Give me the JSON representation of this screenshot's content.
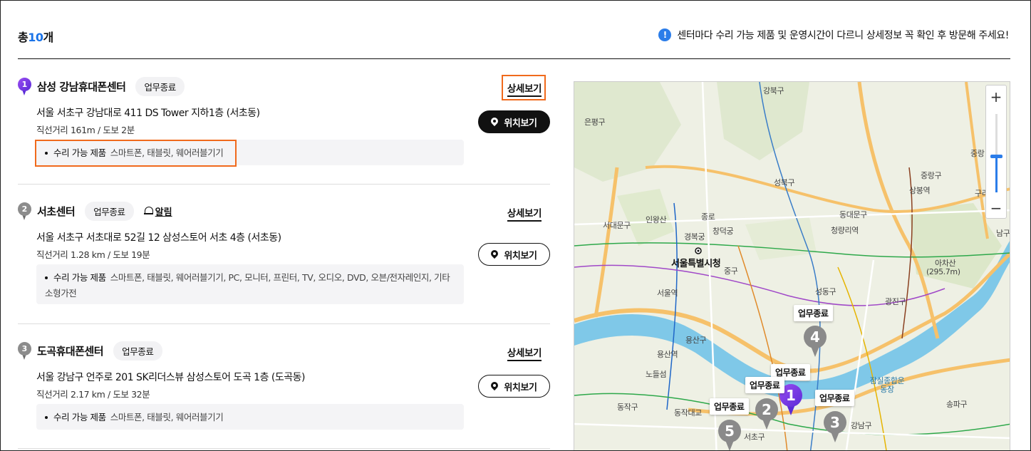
{
  "header": {
    "total_prefix": "총",
    "total_count": "10",
    "total_suffix": "개",
    "notice": "센터마다 수리 가능 제품 및 운영시간이 다르니 상세정보 꼭 확인 후 방문해 주세요!"
  },
  "centers": [
    {
      "number": "1",
      "name": "삼성 강남휴대폰센터",
      "status": "업무종료",
      "address": "서울 서초구 강남대로 411 DS Tower 지하1층 (서초동)",
      "distance": "직선거리 161m / 도보 2분",
      "repair_label": "수리 가능 제품",
      "repair_products": "스마트폰, 태블릿, 웨어러블기기",
      "detail_label": "상세보기",
      "location_label": "위치보기"
    },
    {
      "number": "2",
      "name": "서초센터",
      "status": "업무종료",
      "alarm_label": "알림",
      "address": "서울 서초구 서초대로 52길 12 삼성스토어 서초 4층 (서초동)",
      "distance": "직선거리 1.28 km / 도보 19분",
      "repair_label": "수리 가능 제품",
      "repair_products": "스마트폰, 태블릿, 웨어러블기기, PC, 모니터, 프린터, TV, 오디오, DVD, 오븐/전자레인지, 기타 소형가전",
      "detail_label": "상세보기",
      "location_label": "위치보기"
    },
    {
      "number": "3",
      "name": "도곡휴대폰센터",
      "status": "업무종료",
      "address": "서울 강남구 언주로 201 SK리더스뷰 삼성스토어 도곡 1층 (도곡동)",
      "distance": "직선거리 2.17 km / 도보 32분",
      "repair_label": "수리 가능 제품",
      "repair_products": "스마트폰, 태블릿, 웨어러블기기",
      "detail_label": "상세보기",
      "location_label": "위치보기"
    }
  ],
  "map": {
    "zoom_in": "+",
    "zoom_out": "−",
    "labels": [
      "강북구",
      "은평구",
      "성북구",
      "중랑구",
      "상봉역",
      "중랑",
      "인왕산",
      "종로",
      "창덕궁",
      "경복궁",
      "동대문구",
      "청량리역",
      "서대문구",
      "서울특별시청",
      "중구",
      "서울역",
      "성동구",
      "광진구",
      "아차산",
      "(295.7m)",
      "용산구",
      "용산역",
      "노들섬",
      "동작구",
      "동작대교",
      "서초구",
      "강남구",
      "송파구",
      "잠실종합운동장",
      "구리시",
      "남구"
    ],
    "pins": [
      {
        "number": "1",
        "tag": "업무종료"
      },
      {
        "number": "2",
        "tag": "업무종료"
      },
      {
        "number": "3",
        "tag": "업무종료"
      },
      {
        "number": "4",
        "tag": "업무종료"
      },
      {
        "number": "5",
        "tag": "업무종료"
      }
    ]
  },
  "colors": {
    "accent": "#1a73e8",
    "highlight": "#f06a1c",
    "pin_active": "#6a35e0",
    "pin_inactive": "#8a8a8a",
    "river": "#7fc8e8",
    "highway": "#f6c16a"
  }
}
